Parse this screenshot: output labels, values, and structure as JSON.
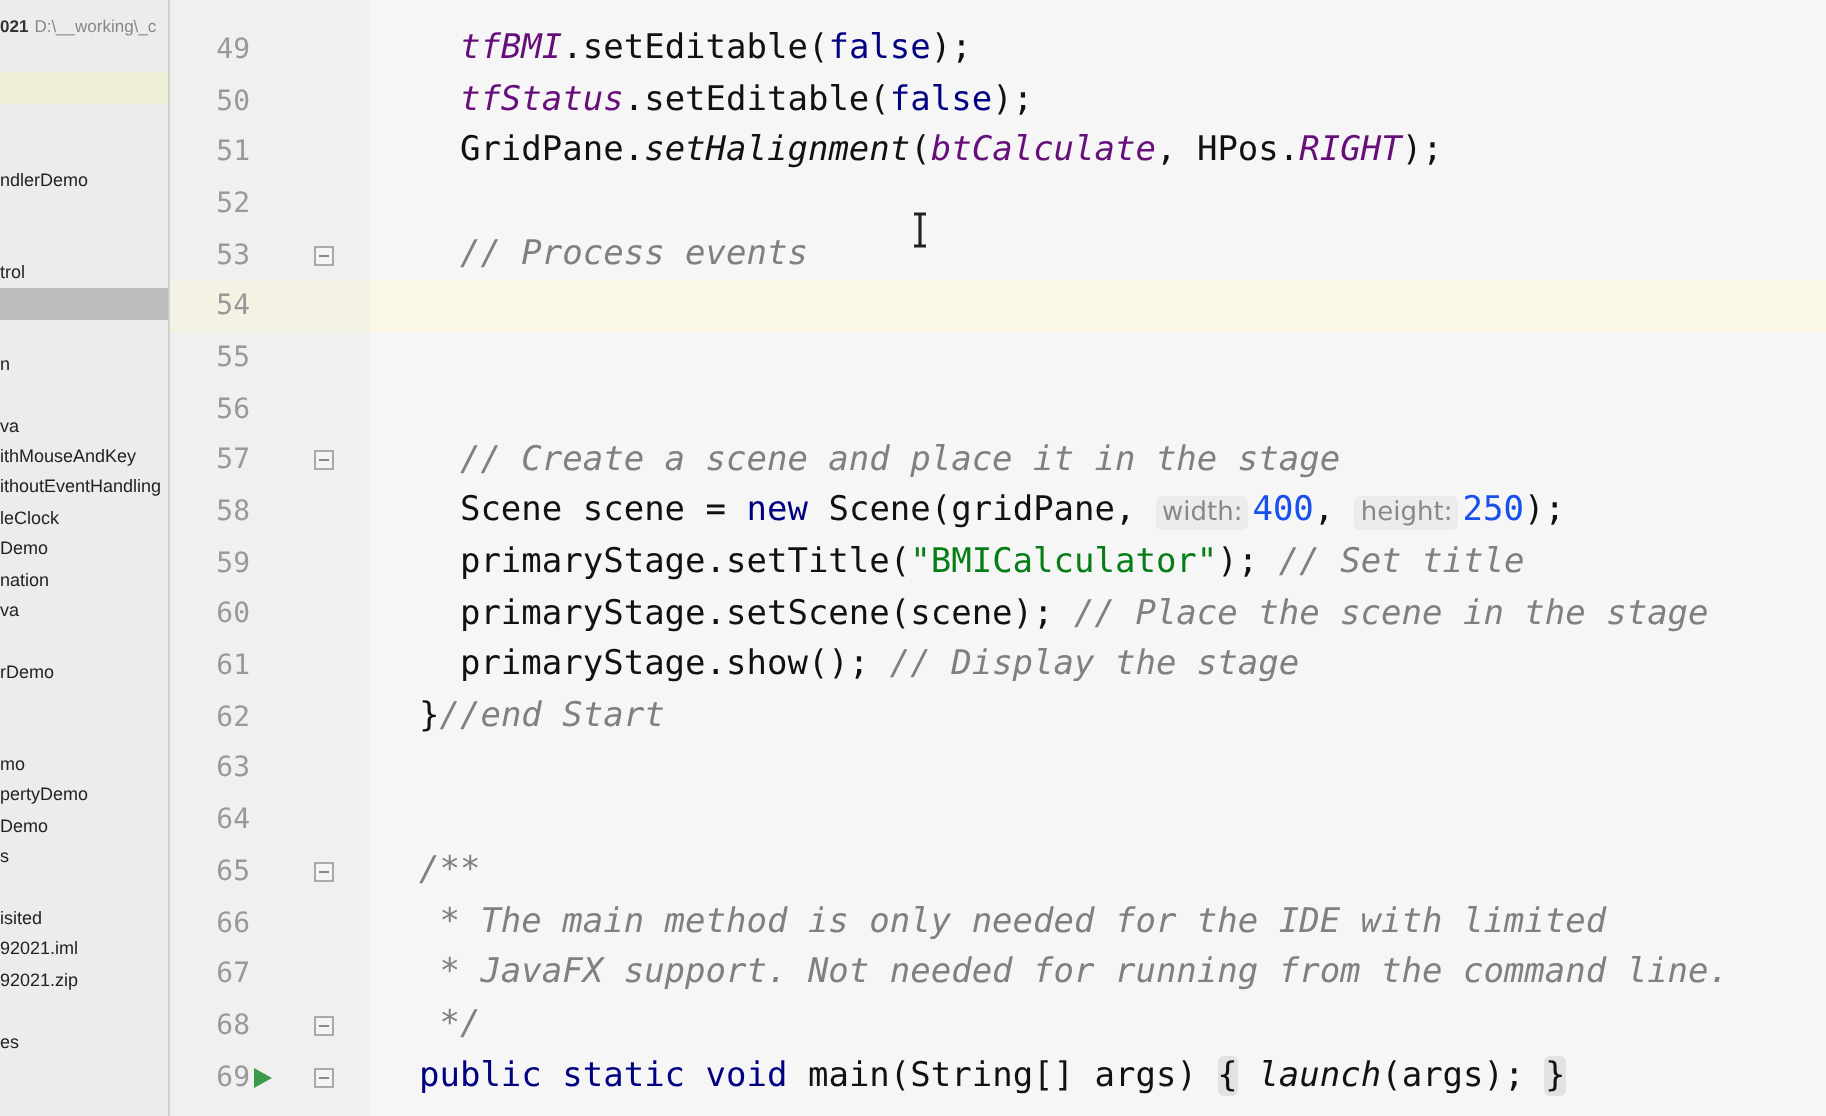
{
  "project_tree": {
    "header": {
      "name": "021",
      "path": "D:\\__working\\_c"
    },
    "items": [
      {
        "selected": false
      },
      {
        "selected": false,
        "highlighted": true
      },
      {
        "selected": false
      },
      {
        "selected": false
      },
      {
        "label": "ndlerDemo",
        "selected": false
      },
      {
        "selected": false
      },
      {
        "selected": false
      },
      {
        "label": "trol",
        "selected": false
      },
      {
        "selected": true
      },
      {
        "selected": false
      },
      {
        "label": "n",
        "selected": false
      },
      {
        "selected": false
      },
      {
        "label": "va",
        "selected": false
      },
      {
        "label": "ithMouseAndKey",
        "selected": false
      },
      {
        "label": "ithoutEventHandling",
        "selected": false
      },
      {
        "label": "leClock",
        "selected": false
      },
      {
        "label": "Demo",
        "selected": false
      },
      {
        "label": "nation",
        "selected": false
      },
      {
        "label": "va",
        "selected": false
      },
      {
        "selected": false
      },
      {
        "label": "rDemo",
        "selected": false
      },
      {
        "selected": false
      },
      {
        "selected": false
      },
      {
        "label": "mo",
        "selected": false
      },
      {
        "label": "pertyDemo",
        "selected": false
      },
      {
        "label": "Demo",
        "selected": false
      },
      {
        "label": "s",
        "selected": false
      },
      {
        "selected": false
      },
      {
        "label": "isited",
        "selected": false
      },
      {
        "label": "92021.iml",
        "selected": false
      },
      {
        "label": "92021.zip",
        "selected": false
      },
      {
        "selected": false
      },
      {
        "label": "es",
        "selected": false
      }
    ]
  },
  "editor": {
    "lines": [
      {
        "number": "49",
        "tokens": [
          {
            "kind": "field",
            "text": "    tfBMI"
          },
          {
            "kind": "plain",
            "text": ".setEditable("
          },
          {
            "kind": "keyword",
            "text": "false"
          },
          {
            "kind": "plain",
            "text": ");"
          }
        ]
      },
      {
        "number": "50",
        "tokens": [
          {
            "kind": "field",
            "text": "    tfStatus"
          },
          {
            "kind": "plain",
            "text": ".setEditable("
          },
          {
            "kind": "keyword",
            "text": "false"
          },
          {
            "kind": "plain",
            "text": ");"
          }
        ]
      },
      {
        "number": "51",
        "tokens": [
          {
            "kind": "plain",
            "text": "    GridPane."
          },
          {
            "kind": "static",
            "text": "setHalignment"
          },
          {
            "kind": "plain",
            "text": "("
          },
          {
            "kind": "field",
            "text": "btCalculate"
          },
          {
            "kind": "plain",
            "text": ", HPos."
          },
          {
            "kind": "field",
            "text": "RIGHT"
          },
          {
            "kind": "plain",
            "text": ");"
          }
        ]
      },
      {
        "number": "52"
      },
      {
        "number": "53",
        "fold": true,
        "tokens": [
          {
            "kind": "comment",
            "text": "    // Process events"
          }
        ]
      },
      {
        "number": "54",
        "current": true
      },
      {
        "number": "55"
      },
      {
        "number": "56"
      },
      {
        "number": "57",
        "fold": true,
        "tokens": [
          {
            "kind": "comment",
            "text": "    // Create a scene and place it in the stage"
          }
        ]
      },
      {
        "number": "58",
        "tokens": [
          {
            "kind": "plain",
            "text": "    Scene scene = "
          },
          {
            "kind": "keyword",
            "text": "new"
          },
          {
            "kind": "plain",
            "text": " Scene(gridPane, "
          },
          {
            "kind": "hint",
            "text": "width:"
          },
          {
            "kind": "number",
            "text": "400"
          },
          {
            "kind": "plain",
            "text": ", "
          },
          {
            "kind": "hint",
            "text": "height:"
          },
          {
            "kind": "number",
            "text": "250"
          },
          {
            "kind": "plain",
            "text": ");"
          }
        ]
      },
      {
        "number": "59",
        "tokens": [
          {
            "kind": "plain",
            "text": "    primaryStage.setTitle("
          },
          {
            "kind": "string",
            "text": "\"BMICalculator\""
          },
          {
            "kind": "plain",
            "text": "); "
          },
          {
            "kind": "comment",
            "text": "// Set title"
          }
        ]
      },
      {
        "number": "60",
        "tokens": [
          {
            "kind": "plain",
            "text": "    primaryStage.setScene(scene); "
          },
          {
            "kind": "comment",
            "text": "// Place the scene in the stage"
          }
        ]
      },
      {
        "number": "61",
        "tokens": [
          {
            "kind": "plain",
            "text": "    primaryStage.show(); "
          },
          {
            "kind": "comment",
            "text": "// Display the stage"
          }
        ]
      },
      {
        "number": "62",
        "tokens": [
          {
            "kind": "plain",
            "text": "  }"
          },
          {
            "kind": "comment",
            "text": "//end Start"
          }
        ]
      },
      {
        "number": "63"
      },
      {
        "number": "64"
      },
      {
        "number": "65",
        "fold": true,
        "tokens": [
          {
            "kind": "comment",
            "text": "  /**"
          }
        ]
      },
      {
        "number": "66",
        "tokens": [
          {
            "kind": "comment",
            "text": "   * The main method is only needed for the IDE with limited"
          }
        ]
      },
      {
        "number": "67",
        "tokens": [
          {
            "kind": "comment",
            "text": "   * JavaFX support. Not needed for running from the command line."
          }
        ]
      },
      {
        "number": "68",
        "fold": true,
        "tokens": [
          {
            "kind": "comment",
            "text": "   */"
          }
        ]
      },
      {
        "number": "69",
        "fold": true,
        "run": true,
        "tokens": [
          {
            "kind": "keyword",
            "text": "  public static void"
          },
          {
            "kind": "plain",
            "text": " main(String[] args) "
          },
          {
            "kind": "folded",
            "text": "{"
          },
          {
            "kind": "static",
            "text": " launch"
          },
          {
            "kind": "plain",
            "text": "(args); "
          },
          {
            "kind": "folded",
            "text": "}"
          }
        ]
      }
    ]
  }
}
